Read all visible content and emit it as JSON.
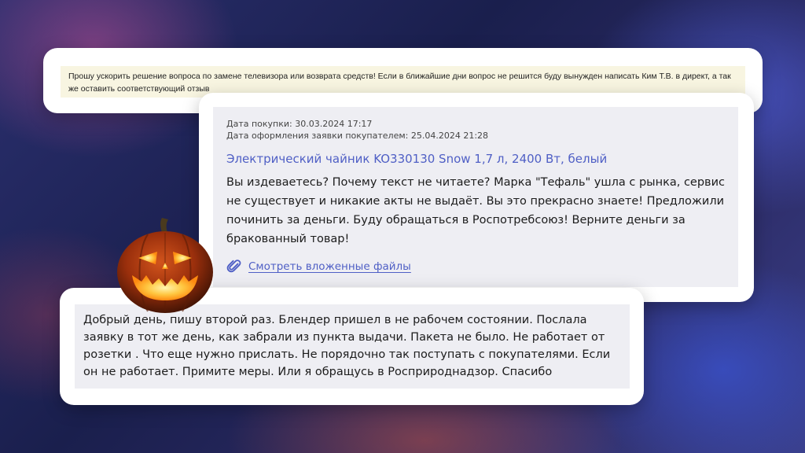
{
  "review_top": {
    "text": "Прошу ускорить решение вопроса по замене телевизора или возврата средств! Если в ближайшие дни вопрос не решится буду вынужден написать Ким Т.В. в директ, а так же оставить соответствующий отзыв"
  },
  "review_middle": {
    "purchase_date": "Дата покупки: 30.03.2024 17:17",
    "request_date": "Дата оформления заявки покупателем: 25.04.2024 21:28",
    "product_name": "Электрический чайник KO330130 Snow 1,7 л, 2400 Вт, белый",
    "message": "Вы издеваетесь? Почему текст не читаете? Марка \"Тефаль\" ушла с рынка, сервис не существует и никакие акты не выдаёт. Вы это прекрасно знаете! Предложили починить за деньги. Буду обращаться в Роспотребсоюз! Верните деньги за бракованный товар!",
    "attachments_link": "Смотреть вложенные файлы",
    "attachment_icon": "paperclip-icon"
  },
  "review_bottom": {
    "text": "Добрый день, пишу второй раз. Блендер пришел в не рабочем состоянии. Послала заявку в тот же день, как забрали из пункта выдачи. Пакета не было. Не работает от розетки . Что еще нужно прислать. Не порядочно так поступать с покупателями. Если он не работает. Примите меры. Или я обращусь в Росприроднадзор. Спасибо"
  },
  "decoration": {
    "icon": "jack-o-lantern-icon"
  },
  "colors": {
    "link": "#4f5fc5",
    "highlight_bg": "#f8f5e1",
    "card_inner_bg": "#eeeef3"
  }
}
